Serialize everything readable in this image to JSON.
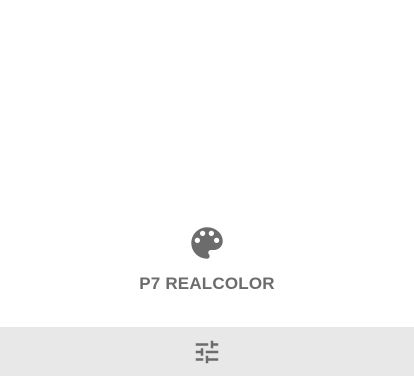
{
  "palette_item": {
    "icon": "palette-icon",
    "label": "P7 REALCOLOR"
  },
  "bottom_bar": {
    "icon": "tune-sliders-icon"
  },
  "colors": {
    "icon_gray": "#6c6c6c",
    "bar_background": "#e8e8e8",
    "page_background": "#ffffff"
  }
}
